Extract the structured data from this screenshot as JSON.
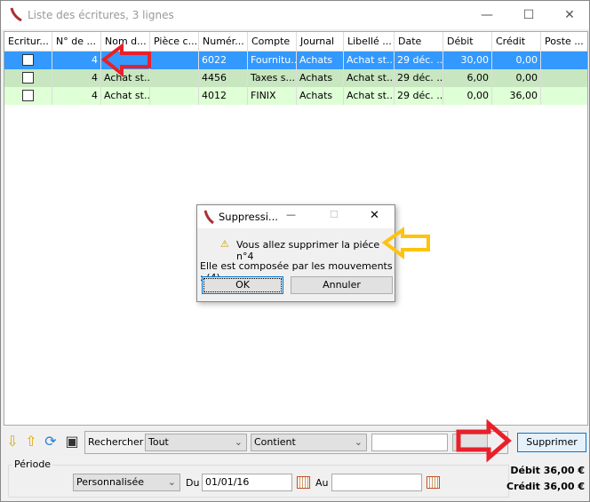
{
  "window": {
    "title": "Liste des écritures, 3 lignes",
    "minimize": "—",
    "maximize": "☐",
    "close": "✕"
  },
  "grid": {
    "columns": [
      "Ecritur...",
      "N° de ...",
      "Nom d...",
      "Pièce c...",
      "Numér...",
      "Compte",
      "Journal",
      "Libellé ...",
      "Date",
      "Débit",
      "Crédit",
      "Poste ..."
    ],
    "rows": [
      {
        "checked": false,
        "num": "4",
        "nom": "",
        "piece": "",
        "numero": "6022",
        "compte": "Fournitu...",
        "journal": "Achats",
        "libelle": "Achat st...",
        "date": "29 déc. ...",
        "debit": "30,00",
        "credit": "0,00",
        "poste": ""
      },
      {
        "checked": false,
        "num": "4",
        "nom": "Achat st...",
        "piece": "",
        "numero": "4456",
        "compte": "Taxes s...",
        "journal": "Achats",
        "libelle": "Achat st...",
        "date": "29 déc. ...",
        "debit": "6,00",
        "credit": "0,00",
        "poste": ""
      },
      {
        "checked": false,
        "num": "4",
        "nom": "Achat st...",
        "piece": "",
        "numero": "4012",
        "compte": "FINIX",
        "journal": "Achats",
        "libelle": "Achat st...",
        "date": "29 déc. ...",
        "debit": "0,00",
        "credit": "36,00",
        "poste": ""
      }
    ]
  },
  "toolbar": {
    "icons": [
      "arrow-down-icon",
      "arrow-up-icon",
      "refresh-icon",
      "save-icon"
    ],
    "search_label": "Rechercher",
    "field": "Tout",
    "operator": "Contient",
    "search_value": "",
    "delete_button": "Supprimer"
  },
  "period": {
    "label": "Période",
    "mode": "Personnalisée",
    "from_label": "Du",
    "from": "01/01/16",
    "to_label": "Au",
    "to": ""
  },
  "totals": {
    "debit": "Débit 36,00 €",
    "credit": "Crédit 36,00 €"
  },
  "dialog": {
    "title": "Suppressi...",
    "message": "Vous allez supprimer la piéce n°4",
    "detail": "Elle est composée par les mouvements : (4)",
    "ok": "OK",
    "cancel": "Annuler"
  },
  "colors": {
    "selection": "#3399ff",
    "row_green": "#c8e6c0",
    "row_light_green": "#dfffd6",
    "annotation_red": "#e8202a",
    "annotation_yellow": "#ffc20e"
  }
}
